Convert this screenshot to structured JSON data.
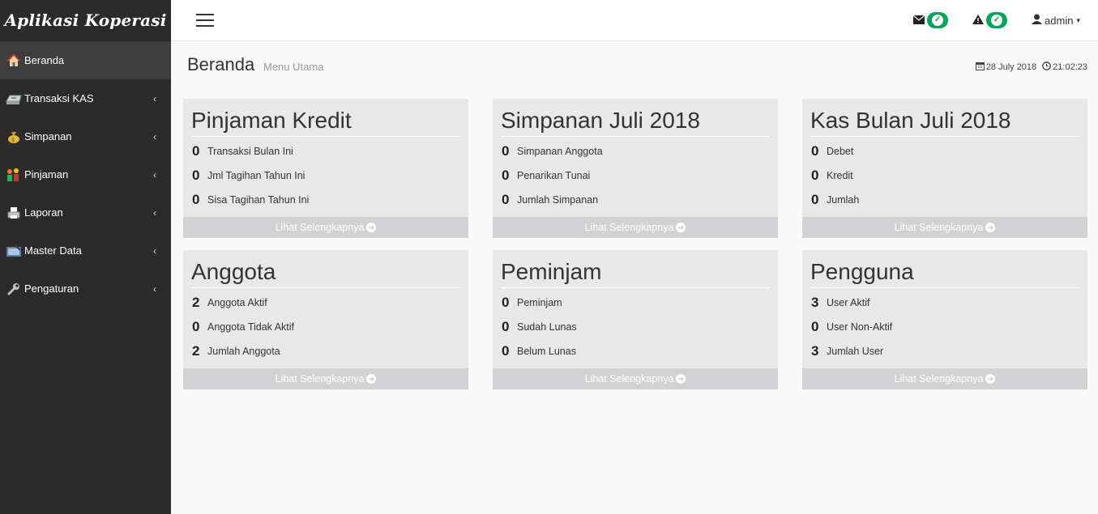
{
  "app": {
    "brand": "Aplikasi Koperasi"
  },
  "sidebar": {
    "items": [
      {
        "label": "Beranda",
        "icon": "house-icon",
        "active": true
      },
      {
        "label": "Transaksi KAS",
        "icon": "cash-register-icon"
      },
      {
        "label": "Simpanan",
        "icon": "money-bag-icon"
      },
      {
        "label": "Pinjaman",
        "icon": "people-icon"
      },
      {
        "label": "Laporan",
        "icon": "printer-icon"
      },
      {
        "label": "Master Data",
        "icon": "database-icon"
      },
      {
        "label": "Pengaturan",
        "icon": "wrench-icon"
      }
    ],
    "chevron": "‹"
  },
  "topbar": {
    "user": "admin",
    "caret": "▾",
    "status_check": "✓"
  },
  "header": {
    "title": "Beranda",
    "subtitle": "Menu Utama",
    "date": "28 July 2018",
    "time": "21:02:23"
  },
  "cards": [
    {
      "title": "Pinjaman Kredit",
      "rows": [
        {
          "num": "0",
          "label": "Transaksi Bulan Ini"
        },
        {
          "num": "0",
          "label": "Jml Tagihan Tahun Ini"
        },
        {
          "num": "0",
          "label": "Sisa Tagihan Tahun Ini"
        }
      ],
      "footer": "Lihat Selengkapnya"
    },
    {
      "title": "Simpanan Juli 2018",
      "rows": [
        {
          "num": "0",
          "label": "Simpanan Anggota"
        },
        {
          "num": "0",
          "label": "Penarikan Tunai"
        },
        {
          "num": "0",
          "label": "Jumlah Simpanan"
        }
      ],
      "footer": "Lihat Selengkapnya"
    },
    {
      "title": "Kas Bulan Juli 2018",
      "rows": [
        {
          "num": "0",
          "label": "Debet"
        },
        {
          "num": "0",
          "label": "Kredit"
        },
        {
          "num": "0",
          "label": "Jumlah"
        }
      ],
      "footer": "Lihat Selengkapnya"
    },
    {
      "title": "Anggota",
      "rows": [
        {
          "num": "2",
          "label": "Anggota Aktif"
        },
        {
          "num": "0",
          "label": "Anggota Tidak Aktif"
        },
        {
          "num": "2",
          "label": "Jumlah Anggota"
        }
      ],
      "footer": "Lihat Selengkapnya"
    },
    {
      "title": "Peminjam",
      "rows": [
        {
          "num": "0",
          "label": "Peminjam"
        },
        {
          "num": "0",
          "label": "Sudah Lunas"
        },
        {
          "num": "0",
          "label": "Belum Lunas"
        }
      ],
      "footer": "Lihat Selengkapnya"
    },
    {
      "title": "Pengguna",
      "rows": [
        {
          "num": "3",
          "label": "User Aktif"
        },
        {
          "num": "0",
          "label": "User Non-Aktif"
        },
        {
          "num": "3",
          "label": "Jumlah User"
        }
      ],
      "footer": "Lihat Selengkapnya"
    }
  ],
  "colors": {
    "sidebar_bg": "#2b2b2b",
    "active_bg": "#3d3d3d",
    "card_bg": "#e8e8e9",
    "card_footer_bg": "#d2d2d4",
    "badge_green": "#00a65a"
  }
}
